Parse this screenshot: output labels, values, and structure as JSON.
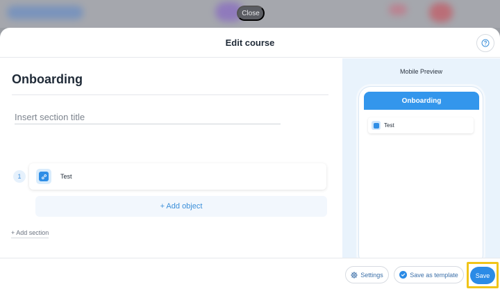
{
  "overlay": {
    "close_label": "Close"
  },
  "modal": {
    "title": "Edit course",
    "help_icon": "question-circle-icon"
  },
  "editor": {
    "course_title": "Onboarding",
    "section_title_placeholder": "Insert section title",
    "objects": [
      {
        "number": "1",
        "label": "Test",
        "icon": "link-icon"
      }
    ],
    "add_object_label": "+ Add object",
    "add_section_label": "+ Add section"
  },
  "preview": {
    "label": "Mobile Preview",
    "header": "Onboarding",
    "items": [
      {
        "label": "Test",
        "icon": "link-icon"
      }
    ]
  },
  "footer": {
    "settings_label": "Settings",
    "settings_icon": "gear-icon",
    "template_label": "Save as template",
    "template_icon": "check-circle-icon",
    "save_label": "Save"
  },
  "colors": {
    "accent": "#2b8be6",
    "highlight": "#f0c419",
    "preview_bg": "#e9f3fc"
  }
}
